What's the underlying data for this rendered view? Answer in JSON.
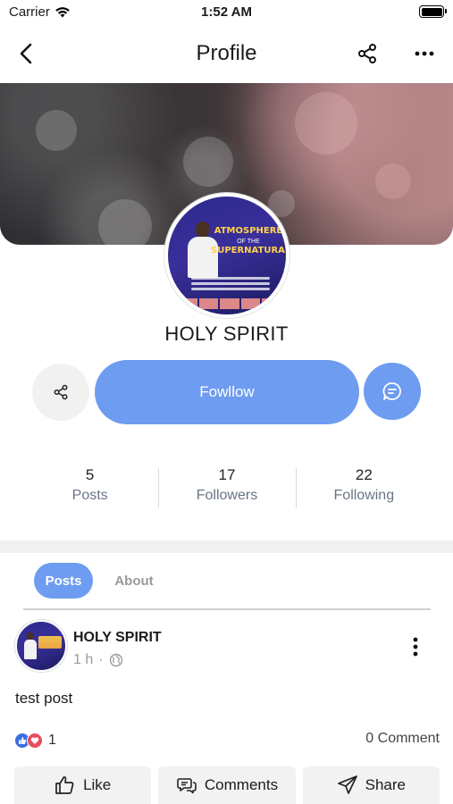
{
  "status_bar": {
    "carrier": "Carrier",
    "time": "1:52 AM"
  },
  "nav": {
    "title": "Profile"
  },
  "profile": {
    "name": "HOLY SPIRIT",
    "avatar_poster": {
      "line1": "ATMOSPHERE",
      "line2": "OF THE",
      "line3": "SUPERNATURAL"
    }
  },
  "actions": {
    "follow_label": "Fowllow"
  },
  "stats": [
    {
      "value": "5",
      "label": "Posts"
    },
    {
      "value": "17",
      "label": "Followers"
    },
    {
      "value": "22",
      "label": "Following"
    }
  ],
  "tabs": {
    "posts": "Posts",
    "about": "About"
  },
  "post": {
    "author": "HOLY SPIRIT",
    "time": "1 h",
    "text": "test post",
    "reaction_count": "1",
    "comment_count": "0 Comment",
    "like_label": "Like",
    "comments_label": "Comments",
    "share_label": "Share"
  },
  "colors": {
    "accent": "#6d9cf0",
    "like": "#3b6fe0",
    "love": "#e94c5c"
  }
}
